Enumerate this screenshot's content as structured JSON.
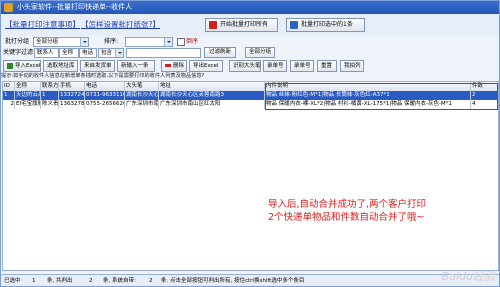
{
  "window": {
    "title": "小头家软件--批量打印快递单--收件人"
  },
  "links": {
    "batch_print_notice": "【批量打印注意事项】",
    "batch_settings": "【怎样设置批打纸张?】"
  },
  "buttons": {
    "start_batch_print": "开始批量打印所有",
    "batch_print_selected": "批量打印选中的1条"
  },
  "filters": {
    "batch_group_label": "批打分组",
    "batch_group_value": "全部分组",
    "sort_label": "排序:",
    "sort_value": "",
    "desc_label": "倒序",
    "keyword_label": "关键字过滤",
    "keyword_field1": "联系人",
    "keyword_field2": "全称",
    "keyword_field3": "电话",
    "keyword_field4": "包含",
    "filter_refresh": "过滤刷新",
    "all_groups": "全部分组"
  },
  "toolbar": [
    {
      "name": "import-excel-button",
      "label": "导入Excel",
      "icon": "excel-icon"
    },
    {
      "name": "select-address-button",
      "label": "选取地址库"
    },
    {
      "name": "add-outgoing-button",
      "label": "来自发货单"
    },
    {
      "name": "add-new-button",
      "label": "新输入一条"
    },
    {
      "name": "delete-button",
      "label": "删除",
      "icon": "delete-icon"
    },
    {
      "name": "export-excel-button",
      "label": "导出Excel"
    },
    {
      "name": "identify-waybill-button",
      "label": "识别大头笔"
    },
    {
      "name": "waybill-no-button",
      "label": "录单号"
    },
    {
      "name": "record-button",
      "label": "录单号"
    },
    {
      "name": "reset-button",
      "label": "重置"
    },
    {
      "name": "print-button",
      "label": "我拍列"
    }
  ],
  "hint": "提示:如手动的收件人信息在新增单条插时选取,以下是需要打印的收件人列表及物品信息?",
  "table": {
    "columns": [
      "ID",
      "全称",
      "联系方",
      "手机",
      "电话",
      "大头笔",
      "地址",
      "内件说明",
      "件数"
    ],
    "rows": [
      {
        "id": "1",
        "name": "天边的云朵台",
        "contact": "1",
        "mobile": "1332724990",
        "phone": "0731-96331106",
        "big_head": "湖南长沙天心区",
        "address": "湖南长沙天心区芙蓉南路3",
        "desc": "物品 丝袜-粉红色-M*1|物品 长筒袜-灰色红-A37*1",
        "count": "2"
      },
      {
        "id": "2",
        "name": "EI宅宝旗舰",
        "contact": "陈义贵",
        "mobile": "136327895",
        "phone": "0755-26566206",
        "big_head": "广东深圳市南山",
        "address": "广东深圳市南山区红太阳",
        "desc": "物品 保暖内衣-裸-XL*2|物品 衬衫-橘黄-XL-175*1|物品 保暖内衣-灰色-M*1",
        "count": "4"
      }
    ]
  },
  "note": "导入后,自动合并成功了,两个客户打印2个快递单物品和件数自动合并了哦~",
  "status": {
    "selected_label": "已选中",
    "selected_count": "1",
    "total_label": "条, 共判出",
    "total_count": "2",
    "system_label": "条, 系统自带:",
    "system_count": "2",
    "tip": "条. 点击全部按钮可判出所有, 按住ctrl换shift选中多个条目"
  },
  "watermark": "Baidu经验"
}
